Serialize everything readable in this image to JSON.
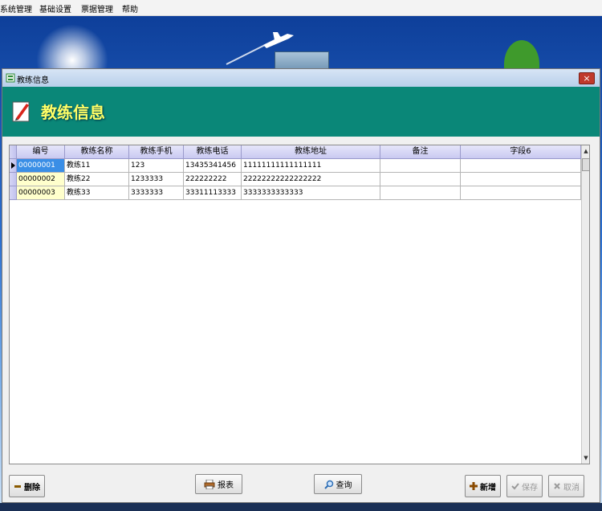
{
  "menubar": {
    "items": [
      {
        "label": "系统管理"
      },
      {
        "label": "基础设置"
      },
      {
        "label": "票据管理"
      },
      {
        "label": "帮助"
      }
    ]
  },
  "window": {
    "title": "教练信息",
    "close_label": "×"
  },
  "banner": {
    "title": "教练信息"
  },
  "grid": {
    "columns": [
      "编号",
      "教练名称",
      "教练手机",
      "教练电话",
      "教练地址",
      "备注",
      "字段6"
    ],
    "rows": [
      [
        "00000001",
        "教练11",
        "123",
        "13435341456",
        "11111111111111111",
        "",
        ""
      ],
      [
        "00000002",
        "教练22",
        "1233333",
        "222222222",
        "22222222222222222",
        "",
        ""
      ],
      [
        "00000003",
        "教练33",
        "3333333",
        "33311113333",
        "3333333333333",
        "",
        ""
      ]
    ],
    "scroll_up": "▲",
    "scroll_down": "▼"
  },
  "buttons": {
    "delete": "删除",
    "report": "报表",
    "query": "查询",
    "add": "新增",
    "save": "保存",
    "cancel": "取消"
  },
  "colors": {
    "banner_bg": "#0a8778",
    "banner_title": "#ffff66",
    "selected_cell": "#3a8ee6",
    "code_cell": "#ffffcc"
  }
}
